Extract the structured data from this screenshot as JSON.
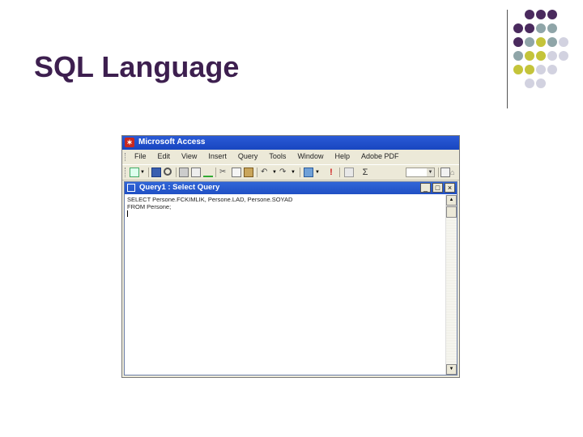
{
  "slide": {
    "title": "SQL Language",
    "colors": {
      "title": "#3d1f4f",
      "dot_purple": "#4a2a5e",
      "dot_teal": "#8fa5a8",
      "dot_olive": "#c4c43a",
      "dot_lavender": "#d2d2e0"
    }
  },
  "app": {
    "title": "Microsoft Access",
    "icon": "access-app-icon",
    "menu": [
      "File",
      "Edit",
      "View",
      "Insert",
      "Query",
      "Tools",
      "Window",
      "Help",
      "Adobe PDF"
    ]
  },
  "toolbar": {
    "icons": [
      "view-icon",
      "dropdown-arrow-icon",
      "save-icon",
      "search-icon",
      "print-icon",
      "print-preview-icon",
      "spelling-icon",
      "cut-icon",
      "copy-icon",
      "paste-icon",
      "undo-icon",
      "redo-icon",
      "query-type-icon",
      "run-icon",
      "show-table-icon",
      "totals-icon",
      "properties-icon",
      "build-icon"
    ],
    "totals_symbol": "Σ",
    "run_symbol": "!"
  },
  "query_window": {
    "title": "Query1 : Select Query",
    "icon": "query-icon",
    "sql_lines": [
      "SELECT Persone.FCKIMLIK, Persone.LAD, Persone.SOYAD",
      "FROM Persone;"
    ],
    "buttons": {
      "minimize": "_",
      "maximize": "□",
      "close": "×"
    },
    "scroll": {
      "up": "▲",
      "down": "▼"
    }
  }
}
